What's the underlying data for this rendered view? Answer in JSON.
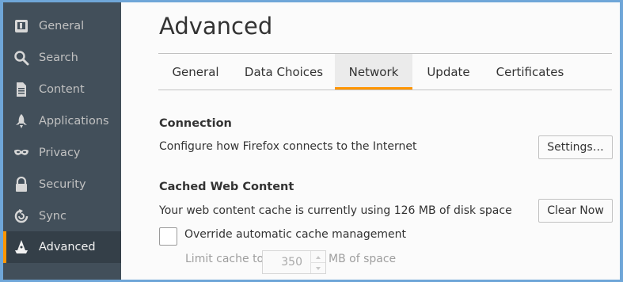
{
  "sidebar": {
    "items": [
      {
        "label": "General",
        "icon": "general-icon"
      },
      {
        "label": "Search",
        "icon": "search-icon"
      },
      {
        "label": "Content",
        "icon": "content-icon"
      },
      {
        "label": "Applications",
        "icon": "applications-icon"
      },
      {
        "label": "Privacy",
        "icon": "privacy-mask-icon"
      },
      {
        "label": "Security",
        "icon": "security-lock-icon"
      },
      {
        "label": "Sync",
        "icon": "sync-icon"
      },
      {
        "label": "Advanced",
        "icon": "advanced-wizard-icon",
        "active": true
      }
    ]
  },
  "page": {
    "title": "Advanced"
  },
  "tabs": [
    {
      "label": "General"
    },
    {
      "label": "Data Choices"
    },
    {
      "label": "Network",
      "selected": true
    },
    {
      "label": "Update"
    },
    {
      "label": "Certificates"
    }
  ],
  "connection": {
    "title": "Connection",
    "description": "Configure how Firefox connects to the Internet",
    "settings_button": "Settings…"
  },
  "cache": {
    "title": "Cached Web Content",
    "description": "Your web content cache is currently using 126 MB of disk space",
    "clear_button": "Clear Now",
    "override_label": "Override automatic cache management",
    "override_checked": false,
    "limit_label": "Limit cache to",
    "limit_value": "350",
    "limit_unit": "MB of space"
  },
  "colors": {
    "accent": "#ff9500",
    "sidebar_bg": "#424f5a",
    "sidebar_active_bg": "#343f48",
    "window_border": "#6fa6d8"
  }
}
